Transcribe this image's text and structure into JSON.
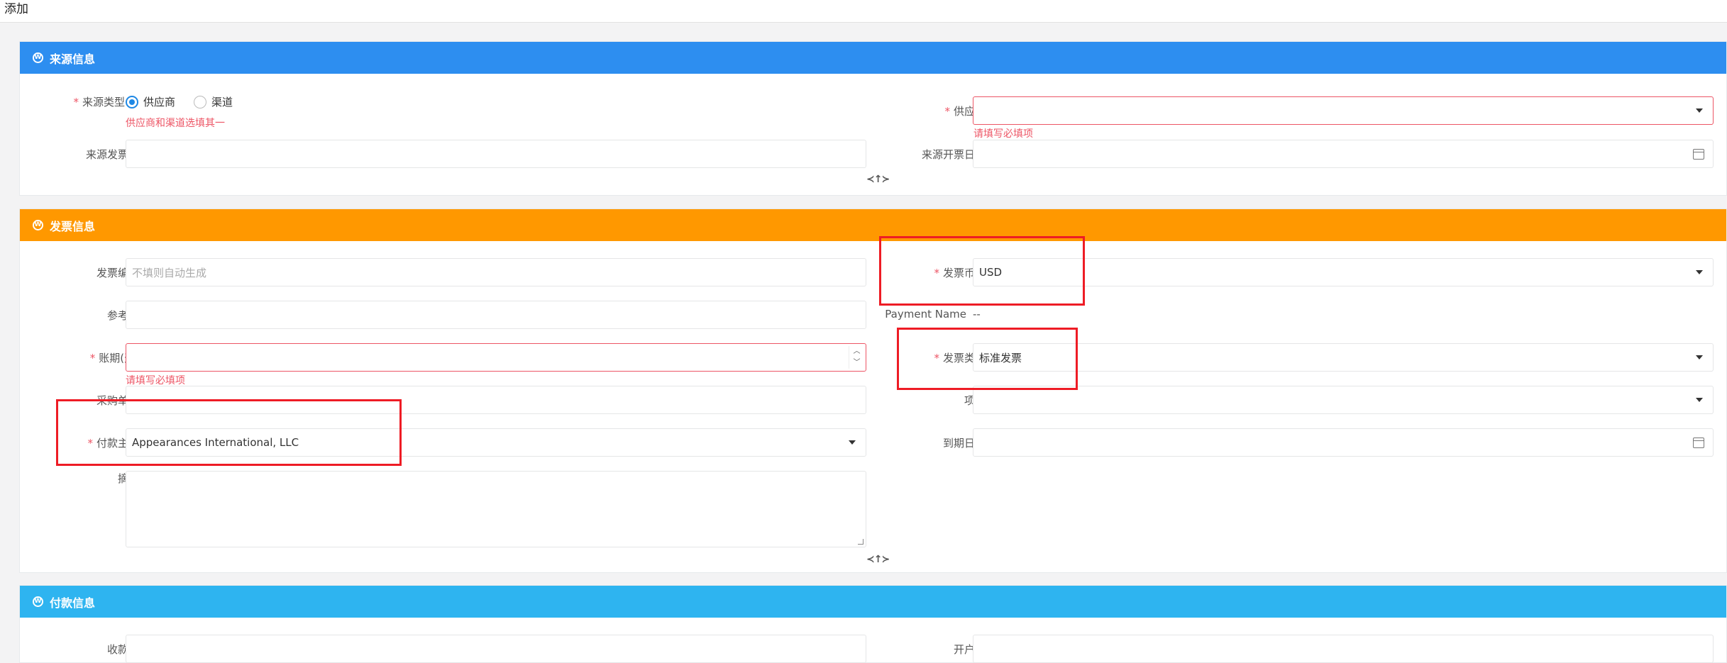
{
  "page": {
    "title": "添加"
  },
  "source_section": {
    "title": "来源信息",
    "color": "#2d8ef0",
    "source_type_label": "来源类型",
    "radio_supplier": "供应商",
    "radio_channel": "渠道",
    "radio_error": "供应商和渠道选填其一",
    "supplier_label": "供应商",
    "supplier_value": "",
    "supplier_error": "请填写必填项",
    "source_invoice_no_label": "来源发票号",
    "source_invoice_no_value": "",
    "source_invoice_date_label": "来源开票日期",
    "source_invoice_date_value": "",
    "toggle": "≺↑≻"
  },
  "invoice_section": {
    "title": "发票信息",
    "color": "#ff9800",
    "invoice_no_label": "发票编号",
    "invoice_no_placeholder": "不填则自动生成",
    "currency_label": "发票币种",
    "currency_value": "USD",
    "reference_label": "参考号",
    "reference_value": "",
    "payment_name_label": "Payment Name",
    "payment_name_value": "--",
    "term_label": "账期(天)",
    "term_value": "",
    "term_error": "请填写必填项",
    "invoice_type_label": "发票类型",
    "invoice_type_value": "标准发票",
    "po_label": "采购单号",
    "po_value": "",
    "project_label": "项目",
    "project_value": "",
    "payer_label": "付款主体",
    "payer_value": "Appearances International, LLC",
    "due_date_label": "到期日期",
    "due_date_value": "",
    "summary_label": "摘要",
    "summary_value": "",
    "toggle": "≺↑≻"
  },
  "payment_section": {
    "title": "付款信息",
    "color": "#2eb4f0",
    "payee_label": "收款方",
    "payee_value": "",
    "bank_label": "开户行",
    "bank_value": ""
  },
  "colors": {
    "required": "#ed5565",
    "highlight": "#ee1c25"
  }
}
